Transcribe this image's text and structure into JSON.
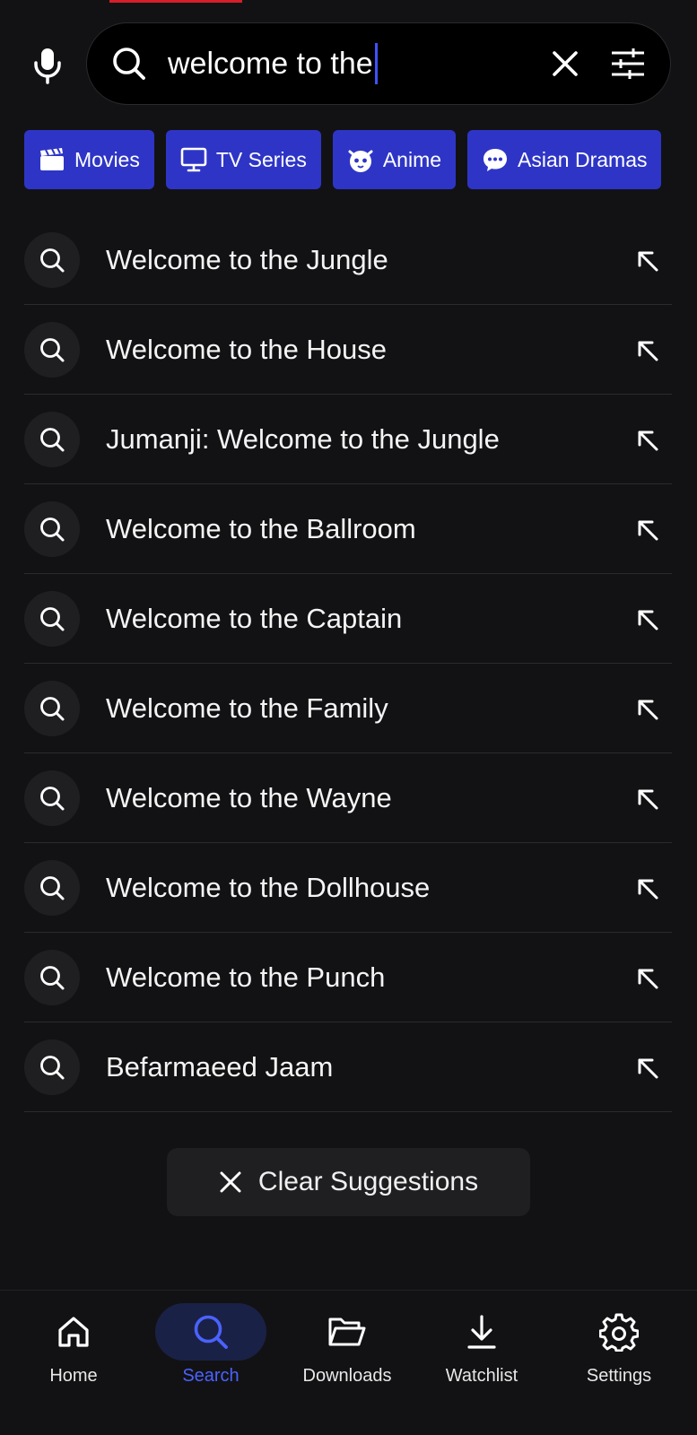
{
  "search": {
    "query": "welcome to the",
    "icons": {
      "mic": "mic-icon",
      "search": "search-icon",
      "clear": "close-icon",
      "filter": "sliders-icon"
    }
  },
  "chips": [
    {
      "label": "Movies",
      "icon": "clapperboard-icon"
    },
    {
      "label": "TV Series",
      "icon": "monitor-icon"
    },
    {
      "label": "Anime",
      "icon": "anime-face-icon"
    },
    {
      "label": "Asian Dramas",
      "icon": "chat-bubble-icon"
    }
  ],
  "suggestions": [
    {
      "text": "Welcome to the Jungle"
    },
    {
      "text": "Welcome to the House"
    },
    {
      "text": "Jumanji: Welcome to the Jungle"
    },
    {
      "text": "Welcome to the Ballroom"
    },
    {
      "text": "Welcome to the Captain"
    },
    {
      "text": "Welcome to the Family"
    },
    {
      "text": "Welcome to the Wayne"
    },
    {
      "text": "Welcome to the Dollhouse"
    },
    {
      "text": "Welcome to the Punch"
    },
    {
      "text": "Befarmaeed Jaam"
    }
  ],
  "clear_suggestions": {
    "label": "Clear Suggestions",
    "icon": "close-icon"
  },
  "nav": {
    "items": [
      {
        "label": "Home",
        "icon": "home-icon",
        "active": false
      },
      {
        "label": "Search",
        "icon": "search-icon",
        "active": true
      },
      {
        "label": "Downloads",
        "icon": "folder-icon",
        "active": false
      },
      {
        "label": "Watchlist",
        "icon": "download-icon",
        "active": false
      },
      {
        "label": "Settings",
        "icon": "gear-icon",
        "active": false
      }
    ]
  },
  "colors": {
    "background": "#121214",
    "accent": "#2e35c6",
    "active_nav": "#4a62ff",
    "search_bar": "#000000",
    "top_accent": "#d61f2a"
  }
}
